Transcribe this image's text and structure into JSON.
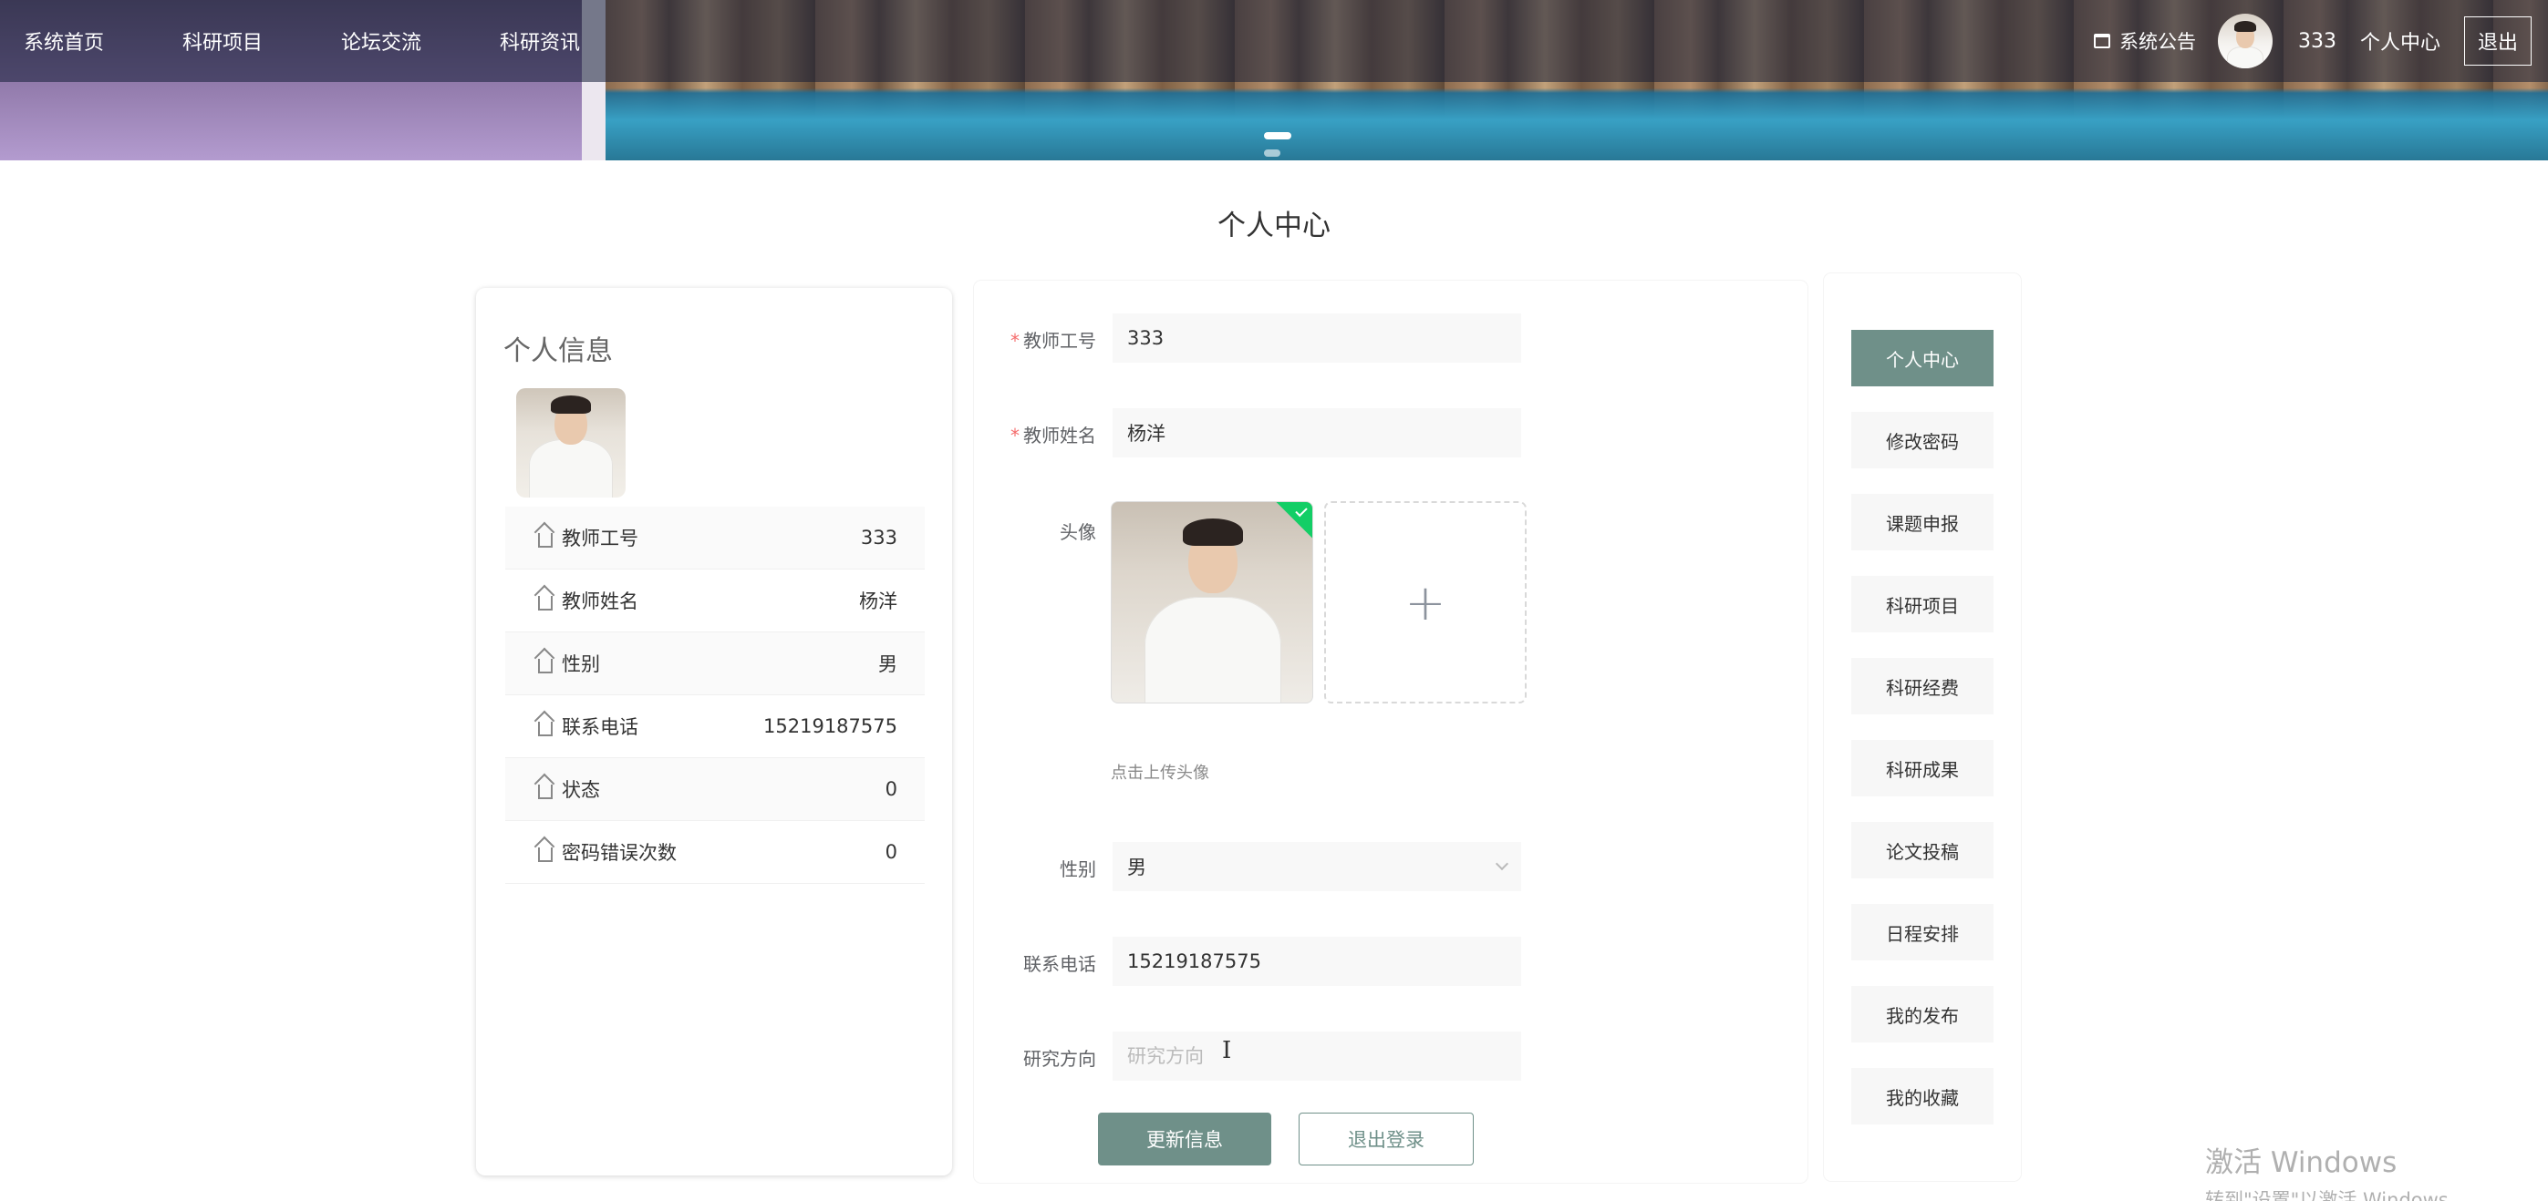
{
  "nav": {
    "items": [
      "系统首页",
      "科研项目",
      "论坛交流",
      "科研资讯"
    ],
    "notice": "系统公告",
    "username": "333",
    "user_center": "个人中心",
    "logout": "退出"
  },
  "page_title": "个人中心",
  "profile_card": {
    "title": "个人信息",
    "rows": [
      {
        "label": "教师工号",
        "value": "333"
      },
      {
        "label": "教师姓名",
        "value": "杨洋"
      },
      {
        "label": "性别",
        "value": "男"
      },
      {
        "label": "联系电话",
        "value": "15219187575"
      },
      {
        "label": "状态",
        "value": "0"
      },
      {
        "label": "密码错误次数",
        "value": "0"
      }
    ]
  },
  "form": {
    "teacher_id_label": "教师工号",
    "teacher_id_value": "333",
    "teacher_name_label": "教师姓名",
    "teacher_name_value": "杨洋",
    "avatar_label": "头像",
    "upload_plus": "+",
    "upload_tip": "点击上传头像",
    "gender_label": "性别",
    "gender_value": "男",
    "phone_label": "联系电话",
    "phone_value": "15219187575",
    "research_label": "研究方向",
    "research_placeholder": "研究方向",
    "required_mark": "*",
    "update_button": "更新信息",
    "logout_button": "退出登录"
  },
  "menu": {
    "items": [
      "个人中心",
      "修改密码",
      "课题申报",
      "科研项目",
      "科研经费",
      "科研成果",
      "论文投稿",
      "日程安排",
      "我的发布",
      "我的收藏"
    ],
    "active_index": 0
  },
  "watermark": {
    "line1": "激活 Windows",
    "line2": "转到\"设置\"以激活 Windows。"
  },
  "colors": {
    "accent": "#6f9089",
    "required": "#f56c6c",
    "success": "#13ce66"
  }
}
